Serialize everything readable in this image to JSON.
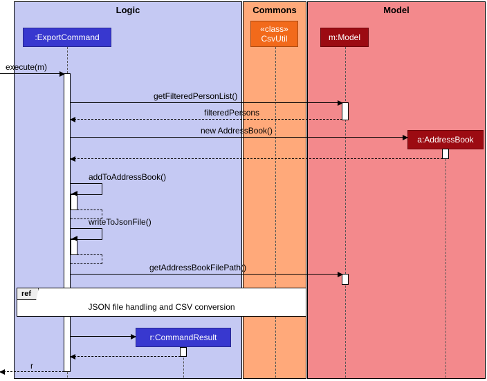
{
  "containers": {
    "logic": "Logic",
    "commons": "Commons",
    "model": "Model"
  },
  "participants": {
    "exportCommand": ":ExportCommand",
    "csvUtilStereo": "«class»",
    "csvUtilName": "CsvUtil",
    "model": "m:Model",
    "addressBook": "a:AddressBook",
    "commandResult": "r:CommandResult"
  },
  "messages": {
    "execute": "execute(m)",
    "getFiltered": "getFilteredPersonList()",
    "filteredPersons": "filteredPersons",
    "newAddressBook": "new AddressBook()",
    "addToAddressBook": "addToAddressBook()",
    "writeToJsonFile": "writeToJsonFile()",
    "getAddressBookFilePath": "getAddressBookFilePath()",
    "returnR": "r"
  },
  "ref": {
    "tag": "ref",
    "text": "JSON file handling and CSV conversion"
  },
  "colors": {
    "logicBg": "#c5c9f3",
    "commonsBg": "#ffa97a",
    "modelBg": "#f3898c",
    "logicBox": "#3838cf",
    "commonsBox": "#f26a1b",
    "modelBox": "#9c0b12"
  }
}
